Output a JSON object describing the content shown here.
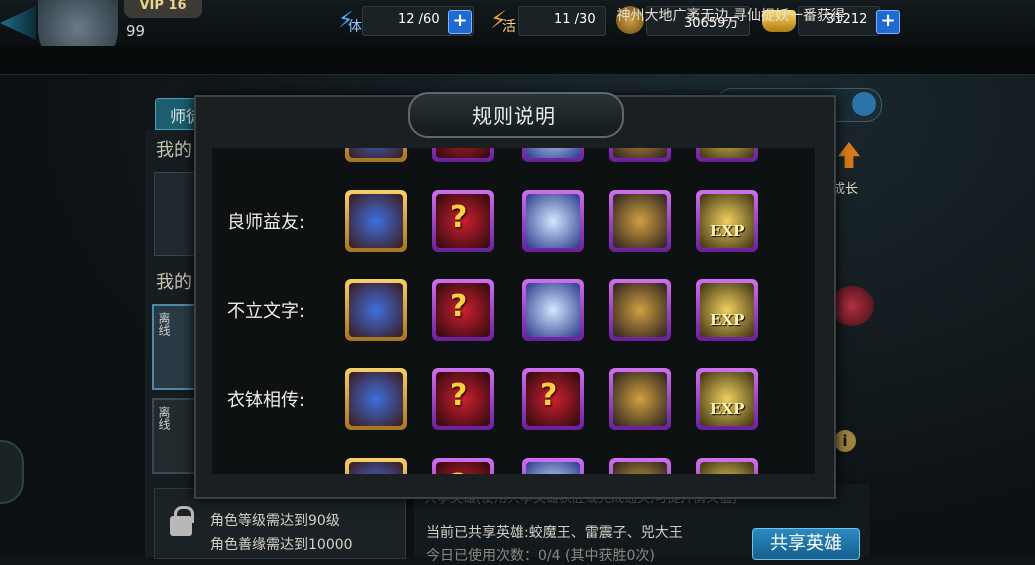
{
  "header": {
    "vip_label": "VIP 16",
    "level": "99",
    "stamina_label": "体",
    "stamina_value": "12 /60",
    "activity_label": "活",
    "activity_value": "11 /30",
    "coins_value": "30659万",
    "ingots_value": "31212",
    "plus_label": "+"
  },
  "ticker": {
    "text": "神州大地广袤无边,寻仙捉妖一番获得"
  },
  "background": {
    "left_tab": "师徒",
    "my_label_1": "我的",
    "my_label_2": "我的",
    "offline_tag_1": "离线",
    "offline_tag_2": "离线",
    "grow_label": "成长",
    "info_label": "i",
    "lock_line_1": "角色等级需达到90级",
    "lock_line_2": "角色善缘需达到10000",
    "share_header": "共享英雄(使用共享英雄获胜或完成通关,可提升情义值)",
    "share_line": "当前已共享英雄:蛟魔王、雷震子、兕大王",
    "share_line2": "今日已使用次数：0/4 (其中获胜0次)",
    "share_button": "共享英雄"
  },
  "dialog": {
    "title": "规则说明",
    "rows": [
      {
        "label": "良师益友:",
        "items": [
          {
            "icon": "scroll-icon",
            "frame": "gold"
          },
          {
            "icon": "mystery-weapon-icon",
            "frame": "purple"
          },
          {
            "icon": "blue-scroll-icon",
            "frame": "purple"
          },
          {
            "icon": "treasure-chest-icon",
            "frame": "purple"
          },
          {
            "icon": "exp-icon",
            "frame": "purple",
            "text": "EXP"
          }
        ]
      },
      {
        "label": "不立文字:",
        "items": [
          {
            "icon": "scroll-icon",
            "frame": "gold"
          },
          {
            "icon": "mystery-armor-icon",
            "frame": "purple"
          },
          {
            "icon": "blue-scroll-icon",
            "frame": "purple"
          },
          {
            "icon": "treasure-chest-icon",
            "frame": "purple"
          },
          {
            "icon": "exp-icon",
            "frame": "purple",
            "text": "EXP"
          }
        ]
      },
      {
        "label": "衣钵相传:",
        "items": [
          {
            "icon": "scroll-icon",
            "frame": "gold"
          },
          {
            "icon": "mystery-armor-icon",
            "frame": "purple"
          },
          {
            "icon": "mystery-orb-icon",
            "frame": "purple"
          },
          {
            "icon": "treasure-chest-icon",
            "frame": "purple"
          },
          {
            "icon": "exp-icon",
            "frame": "purple",
            "text": "EXP"
          }
        ]
      }
    ]
  },
  "colors": {
    "gold_frame": "#f6d06a",
    "purple_frame": "#d070f0",
    "accent_blue": "#1e6ad0"
  }
}
